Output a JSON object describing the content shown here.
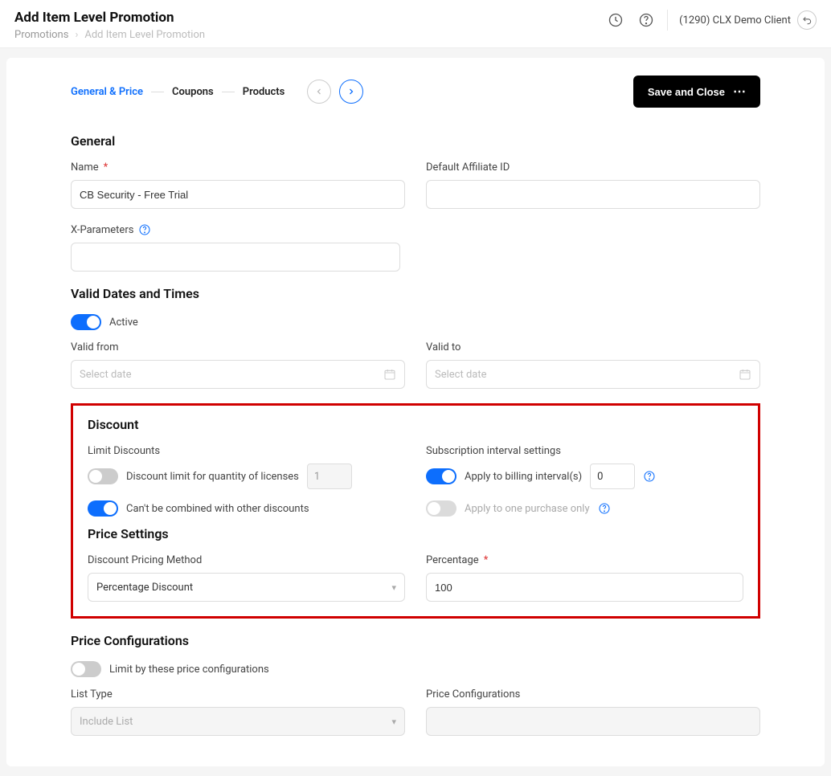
{
  "header": {
    "title": "Add Item Level Promotion",
    "breadcrumb": {
      "root": "Promotions",
      "current": "Add Item Level Promotion"
    },
    "client": "(1290) CLX Demo Client"
  },
  "tabs": {
    "t1": "General & Price",
    "t2": "Coupons",
    "t3": "Products"
  },
  "actions": {
    "save": "Save and Close"
  },
  "general": {
    "section": "General",
    "name_label": "Name",
    "name_value": "CB Security - Free Trial",
    "affiliate_label": "Default Affiliate ID",
    "xparam_label": "X-Parameters"
  },
  "valid": {
    "section": "Valid Dates and Times",
    "active_label": "Active",
    "from_label": "Valid from",
    "to_label": "Valid to",
    "date_placeholder": "Select date"
  },
  "discount": {
    "section": "Discount",
    "limit_label": "Limit Discounts",
    "limit_toggle_label": "Discount limit for quantity of licenses",
    "limit_value": "1",
    "combine_label": "Can't be combined with other discounts",
    "sub_settings_label": "Subscription interval settings",
    "apply_interval_label": "Apply to billing interval(s)",
    "apply_interval_value": "0",
    "apply_once_label": "Apply to one purchase only"
  },
  "price_settings": {
    "section": "Price Settings",
    "method_label": "Discount Pricing Method",
    "method_value": "Percentage Discount",
    "percentage_label": "Percentage",
    "percentage_value": "100"
  },
  "price_config": {
    "section": "Price Configurations",
    "limit_label": "Limit by these price configurations",
    "list_type_label": "List Type",
    "list_type_value": "Include List",
    "config_label": "Price Configurations"
  }
}
